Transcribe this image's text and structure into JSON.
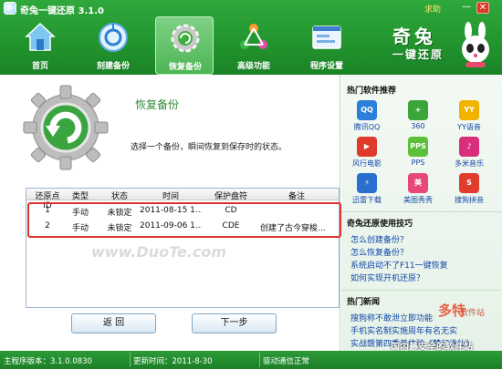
{
  "window": {
    "title": "奇兔一键还原 3.1.0",
    "help": "求助",
    "minimize": "—",
    "close": "✕"
  },
  "nav": [
    {
      "label": "首页",
      "icon": "home-icon"
    },
    {
      "label": "刻建备份",
      "icon": "create-backup-icon"
    },
    {
      "label": "恢复备份",
      "icon": "restore-icon",
      "active": true
    },
    {
      "label": "高级功能",
      "icon": "advanced-icon"
    },
    {
      "label": "程序设置",
      "icon": "settings-icon"
    }
  ],
  "brand": {
    "line1": "奇兔",
    "line2": "一键还原"
  },
  "main": {
    "title": "恢复备份",
    "description": "选择一个备份，瞬间恢复到保存时的状态。",
    "watermark": "www.DuoTe.com",
    "table": {
      "headers": [
        "还原点ID",
        "类型",
        "状态",
        "时间",
        "保护盘符",
        "备注"
      ],
      "rows": [
        [
          "1",
          "手动",
          "未锁定",
          "2011-08-15 1...",
          "CD",
          ""
        ],
        [
          "2",
          "手动",
          "未锁定",
          "2011-09-06 1...",
          "CDE",
          "创建了古今穿梭..."
        ]
      ]
    },
    "back_label": "返  回",
    "next_label": "下一步"
  },
  "side": {
    "hot_title": "热门软件推荐",
    "apps": [
      {
        "name": "腾讯QQ",
        "icon": "qq-icon",
        "color": "#2b7fd8",
        "glyph": "QQ"
      },
      {
        "name": "360",
        "icon": "360-icon",
        "color": "#3aa63a",
        "glyph": "+"
      },
      {
        "name": "YY语音",
        "icon": "yy-icon",
        "color": "#f0b400",
        "glyph": "YY"
      },
      {
        "name": "风行电影",
        "icon": "funshion-icon",
        "color": "#e03a2c",
        "glyph": "▶"
      },
      {
        "name": "PPS",
        "icon": "pps-icon",
        "color": "#5cbf3a",
        "glyph": "PPS"
      },
      {
        "name": "多米音乐",
        "icon": "duomi-icon",
        "color": "#d92e7b",
        "glyph": "♪"
      },
      {
        "name": "迅雷下载",
        "icon": "xunlei-icon",
        "color": "#2a6fd0",
        "glyph": "⚡"
      },
      {
        "name": "美图秀秀",
        "icon": "meitu-icon",
        "color": "#e8477b",
        "glyph": "美"
      },
      {
        "name": "搜狗拼音",
        "icon": "sogou-icon",
        "color": "#e03c2e",
        "glyph": "S"
      }
    ],
    "tips_title": "奇兔还原使用技巧",
    "tips": [
      "怎么创建备份？",
      "怎么恢复备份？",
      "系统启动不了F11一键恢复",
      "如何实现开机还原？"
    ],
    "news_title": "热门新闻",
    "news": [
      "搜狗称不敢泄立即功能",
      "手机实名制实施周年有名无实",
      "实战赣第四季美体验《梦幻诛仙》"
    ],
    "badge": {
      "line1": "多特",
      "line2": "软件站",
      "line3": "国内最安全的软件站"
    }
  },
  "status": {
    "version": "主程序版本：3.1.0.0830",
    "updated": "更新时间：2011-8-30",
    "driver": "驱动通信正常"
  }
}
